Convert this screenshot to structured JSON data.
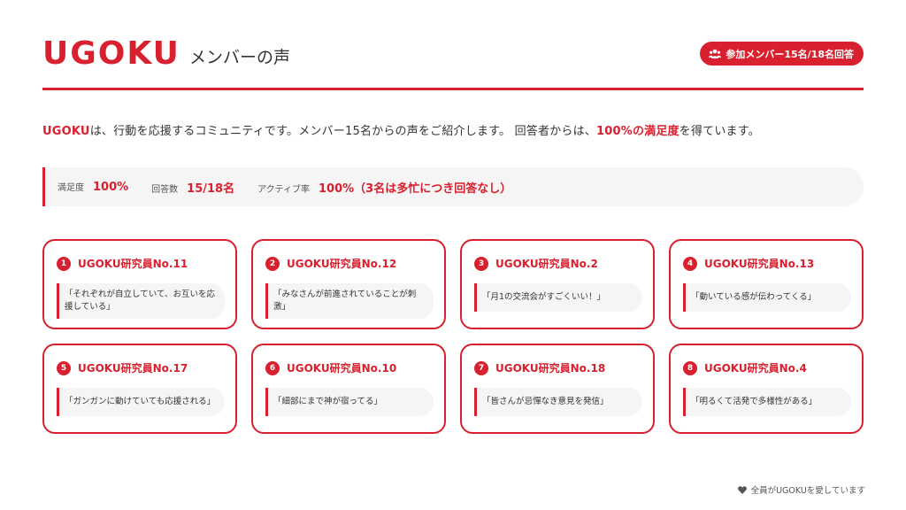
{
  "header": {
    "logo": "UGOKU",
    "title": "メンバーの声",
    "badge_label": "参加メンバー15名/18名回答"
  },
  "intro": {
    "brand": "UGOKU",
    "text_before": "は、行動を応援するコミュニティです。メンバー15名からの声をご紹介します。 回答者からは、",
    "highlight": "100%の満足度",
    "text_after": "を得ています。"
  },
  "stats": [
    {
      "label": "満足度",
      "value": "100%"
    },
    {
      "label": "回答数",
      "value": "15/18名"
    },
    {
      "label": "アクティブ率",
      "value": "100%（3名は多忙につき回答なし）"
    }
  ],
  "cards": [
    {
      "num": "1",
      "title": "UGOKU研究員No.11",
      "quote": "「それぞれが自立していて、お互いを応援している」"
    },
    {
      "num": "2",
      "title": "UGOKU研究員No.12",
      "quote": "「みなさんが前進されていることが刺激」"
    },
    {
      "num": "3",
      "title": "UGOKU研究員No.2",
      "quote": "「月1の交流会がすごくいい！」"
    },
    {
      "num": "4",
      "title": "UGOKU研究員No.13",
      "quote": "「動いている感が伝わってくる」"
    },
    {
      "num": "5",
      "title": "UGOKU研究員No.17",
      "quote": "「ガンガンに動けていても応援される」"
    },
    {
      "num": "6",
      "title": "UGOKU研究員No.10",
      "quote": "「細部にまで神が宿ってる」"
    },
    {
      "num": "7",
      "title": "UGOKU研究員No.18",
      "quote": "「皆さんが忌憚なき意見を発信」"
    },
    {
      "num": "8",
      "title": "UGOKU研究員No.4",
      "quote": "「明るくて活発で多様性がある」"
    }
  ],
  "footer": {
    "icon": "heart-icon",
    "text": "全員がUGOKUを愛しています"
  },
  "colors": {
    "accent": "#d9202f",
    "panel": "#f5f5f5"
  }
}
